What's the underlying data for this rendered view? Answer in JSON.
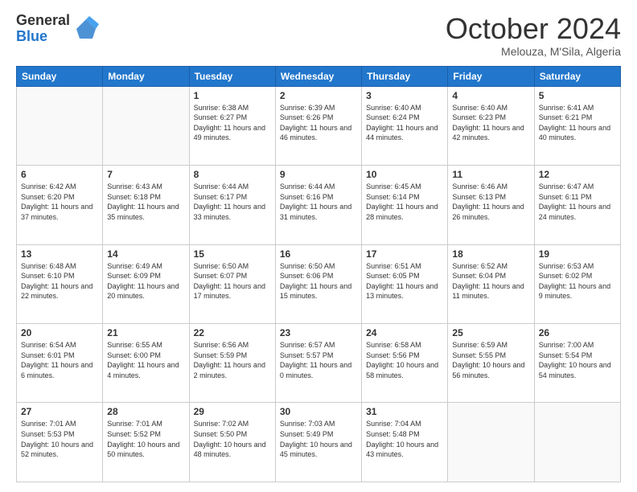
{
  "header": {
    "logo_general": "General",
    "logo_blue": "Blue",
    "month_title": "October 2024",
    "location": "Melouza, M'Sila, Algeria"
  },
  "weekdays": [
    "Sunday",
    "Monday",
    "Tuesday",
    "Wednesday",
    "Thursday",
    "Friday",
    "Saturday"
  ],
  "weeks": [
    [
      {
        "day": "",
        "sunrise": "",
        "sunset": "",
        "daylight": ""
      },
      {
        "day": "",
        "sunrise": "",
        "sunset": "",
        "daylight": ""
      },
      {
        "day": "1",
        "sunrise": "Sunrise: 6:38 AM",
        "sunset": "Sunset: 6:27 PM",
        "daylight": "Daylight: 11 hours and 49 minutes."
      },
      {
        "day": "2",
        "sunrise": "Sunrise: 6:39 AM",
        "sunset": "Sunset: 6:26 PM",
        "daylight": "Daylight: 11 hours and 46 minutes."
      },
      {
        "day": "3",
        "sunrise": "Sunrise: 6:40 AM",
        "sunset": "Sunset: 6:24 PM",
        "daylight": "Daylight: 11 hours and 44 minutes."
      },
      {
        "day": "4",
        "sunrise": "Sunrise: 6:40 AM",
        "sunset": "Sunset: 6:23 PM",
        "daylight": "Daylight: 11 hours and 42 minutes."
      },
      {
        "day": "5",
        "sunrise": "Sunrise: 6:41 AM",
        "sunset": "Sunset: 6:21 PM",
        "daylight": "Daylight: 11 hours and 40 minutes."
      }
    ],
    [
      {
        "day": "6",
        "sunrise": "Sunrise: 6:42 AM",
        "sunset": "Sunset: 6:20 PM",
        "daylight": "Daylight: 11 hours and 37 minutes."
      },
      {
        "day": "7",
        "sunrise": "Sunrise: 6:43 AM",
        "sunset": "Sunset: 6:18 PM",
        "daylight": "Daylight: 11 hours and 35 minutes."
      },
      {
        "day": "8",
        "sunrise": "Sunrise: 6:44 AM",
        "sunset": "Sunset: 6:17 PM",
        "daylight": "Daylight: 11 hours and 33 minutes."
      },
      {
        "day": "9",
        "sunrise": "Sunrise: 6:44 AM",
        "sunset": "Sunset: 6:16 PM",
        "daylight": "Daylight: 11 hours and 31 minutes."
      },
      {
        "day": "10",
        "sunrise": "Sunrise: 6:45 AM",
        "sunset": "Sunset: 6:14 PM",
        "daylight": "Daylight: 11 hours and 28 minutes."
      },
      {
        "day": "11",
        "sunrise": "Sunrise: 6:46 AM",
        "sunset": "Sunset: 6:13 PM",
        "daylight": "Daylight: 11 hours and 26 minutes."
      },
      {
        "day": "12",
        "sunrise": "Sunrise: 6:47 AM",
        "sunset": "Sunset: 6:11 PM",
        "daylight": "Daylight: 11 hours and 24 minutes."
      }
    ],
    [
      {
        "day": "13",
        "sunrise": "Sunrise: 6:48 AM",
        "sunset": "Sunset: 6:10 PM",
        "daylight": "Daylight: 11 hours and 22 minutes."
      },
      {
        "day": "14",
        "sunrise": "Sunrise: 6:49 AM",
        "sunset": "Sunset: 6:09 PM",
        "daylight": "Daylight: 11 hours and 20 minutes."
      },
      {
        "day": "15",
        "sunrise": "Sunrise: 6:50 AM",
        "sunset": "Sunset: 6:07 PM",
        "daylight": "Daylight: 11 hours and 17 minutes."
      },
      {
        "day": "16",
        "sunrise": "Sunrise: 6:50 AM",
        "sunset": "Sunset: 6:06 PM",
        "daylight": "Daylight: 11 hours and 15 minutes."
      },
      {
        "day": "17",
        "sunrise": "Sunrise: 6:51 AM",
        "sunset": "Sunset: 6:05 PM",
        "daylight": "Daylight: 11 hours and 13 minutes."
      },
      {
        "day": "18",
        "sunrise": "Sunrise: 6:52 AM",
        "sunset": "Sunset: 6:04 PM",
        "daylight": "Daylight: 11 hours and 11 minutes."
      },
      {
        "day": "19",
        "sunrise": "Sunrise: 6:53 AM",
        "sunset": "Sunset: 6:02 PM",
        "daylight": "Daylight: 11 hours and 9 minutes."
      }
    ],
    [
      {
        "day": "20",
        "sunrise": "Sunrise: 6:54 AM",
        "sunset": "Sunset: 6:01 PM",
        "daylight": "Daylight: 11 hours and 6 minutes."
      },
      {
        "day": "21",
        "sunrise": "Sunrise: 6:55 AM",
        "sunset": "Sunset: 6:00 PM",
        "daylight": "Daylight: 11 hours and 4 minutes."
      },
      {
        "day": "22",
        "sunrise": "Sunrise: 6:56 AM",
        "sunset": "Sunset: 5:59 PM",
        "daylight": "Daylight: 11 hours and 2 minutes."
      },
      {
        "day": "23",
        "sunrise": "Sunrise: 6:57 AM",
        "sunset": "Sunset: 5:57 PM",
        "daylight": "Daylight: 11 hours and 0 minutes."
      },
      {
        "day": "24",
        "sunrise": "Sunrise: 6:58 AM",
        "sunset": "Sunset: 5:56 PM",
        "daylight": "Daylight: 10 hours and 58 minutes."
      },
      {
        "day": "25",
        "sunrise": "Sunrise: 6:59 AM",
        "sunset": "Sunset: 5:55 PM",
        "daylight": "Daylight: 10 hours and 56 minutes."
      },
      {
        "day": "26",
        "sunrise": "Sunrise: 7:00 AM",
        "sunset": "Sunset: 5:54 PM",
        "daylight": "Daylight: 10 hours and 54 minutes."
      }
    ],
    [
      {
        "day": "27",
        "sunrise": "Sunrise: 7:01 AM",
        "sunset": "Sunset: 5:53 PM",
        "daylight": "Daylight: 10 hours and 52 minutes."
      },
      {
        "day": "28",
        "sunrise": "Sunrise: 7:01 AM",
        "sunset": "Sunset: 5:52 PM",
        "daylight": "Daylight: 10 hours and 50 minutes."
      },
      {
        "day": "29",
        "sunrise": "Sunrise: 7:02 AM",
        "sunset": "Sunset: 5:50 PM",
        "daylight": "Daylight: 10 hours and 48 minutes."
      },
      {
        "day": "30",
        "sunrise": "Sunrise: 7:03 AM",
        "sunset": "Sunset: 5:49 PM",
        "daylight": "Daylight: 10 hours and 45 minutes."
      },
      {
        "day": "31",
        "sunrise": "Sunrise: 7:04 AM",
        "sunset": "Sunset: 5:48 PM",
        "daylight": "Daylight: 10 hours and 43 minutes."
      },
      {
        "day": "",
        "sunrise": "",
        "sunset": "",
        "daylight": ""
      },
      {
        "day": "",
        "sunrise": "",
        "sunset": "",
        "daylight": ""
      }
    ]
  ]
}
